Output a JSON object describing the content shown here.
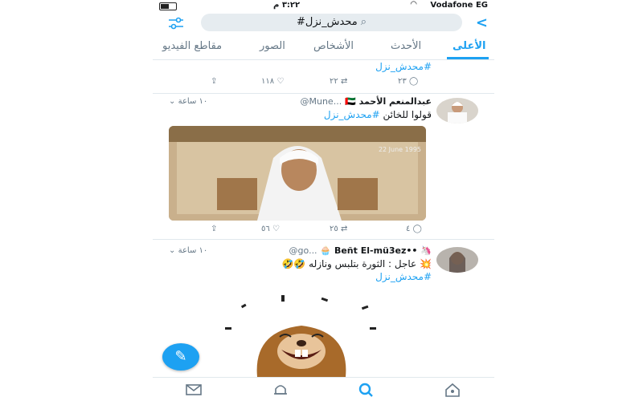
{
  "status_bar": {
    "carrier": "Vodafone EG",
    "time": "٣:٢٢ م"
  },
  "search": {
    "query": "#محدش_نزل"
  },
  "tabs": [
    {
      "label": "الأعلى",
      "active": true
    },
    {
      "label": "الأحدث"
    },
    {
      "label": "الأشخاص"
    },
    {
      "label": "الصور"
    },
    {
      "label": "مقاطع الفيديو"
    }
  ],
  "tweets": [
    {
      "partial_text": "#محدش_نزل",
      "replies": "٢٣",
      "retweets": "٢٢",
      "likes": "١١٨"
    },
    {
      "name": "عبدالمنعم الأحمد",
      "handle": "@Mune...",
      "time": "١٠ ساعة",
      "text": "قولوا للخائن",
      "hashtag": "#محدش_نزل",
      "replies": "٤",
      "retweets": "٢٥",
      "likes": "٥٦",
      "media_caption": "22 June 1995"
    },
    {
      "name": "Beñt El-mü3ez••",
      "handle": "@go...",
      "time": "١٠ ساعة",
      "text": "عاجل : الثورة بتلبس ونازله 🤣🤣",
      "hashtag": "#محدش_نزل"
    }
  ],
  "icons": [
    "filter-icon",
    "back-icon",
    "search-icon",
    "reply-icon",
    "retweet-icon",
    "like-icon",
    "share-icon",
    "compose-icon",
    "mail-icon",
    "bell-icon",
    "home-icon"
  ],
  "colors": {
    "accent": "#1da1f2",
    "muted": "#657786"
  }
}
